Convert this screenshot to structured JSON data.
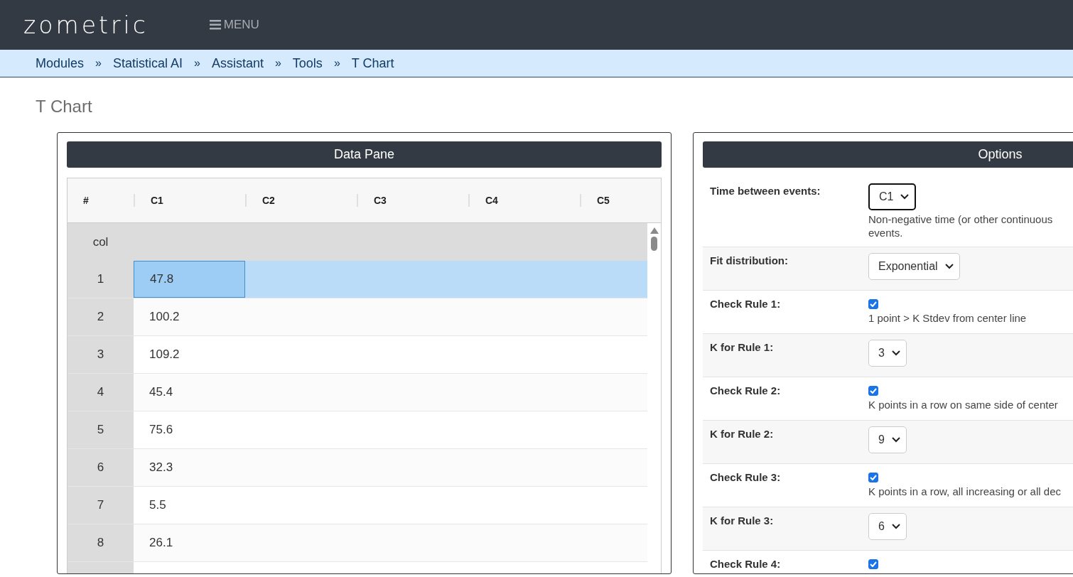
{
  "navbar": {
    "logo": "zometric",
    "menu_label": "MENU"
  },
  "breadcrumb": [
    "Modules",
    "Statistical AI",
    "Assistant",
    "Tools",
    "T Chart"
  ],
  "breadcrumb_separator": "»",
  "page_title": "T Chart",
  "data_pane": {
    "title": "Data Pane",
    "columns": [
      "#",
      "C1",
      "C2",
      "C3",
      "C4",
      "C5"
    ],
    "name_row_label": "col",
    "rows": [
      {
        "number": "1",
        "value": "47.8",
        "selected": true
      },
      {
        "number": "2",
        "value": "100.2",
        "selected": false
      },
      {
        "number": "3",
        "value": "109.2",
        "selected": false
      },
      {
        "number": "4",
        "value": "45.4",
        "selected": false
      },
      {
        "number": "5",
        "value": "75.6",
        "selected": false
      },
      {
        "number": "6",
        "value": "32.3",
        "selected": false
      },
      {
        "number": "7",
        "value": "5.5",
        "selected": false
      },
      {
        "number": "8",
        "value": "26.1",
        "selected": false
      }
    ]
  },
  "options": {
    "title": "Options",
    "rows": [
      {
        "kind": "select",
        "label": "Time between events:",
        "value": "C1",
        "focused": true,
        "hint_lines": [
          "Non-negative time (or other continuous",
          "events."
        ]
      },
      {
        "kind": "select",
        "label": "Fit distribution:",
        "value": "Exponential",
        "focused": false
      },
      {
        "kind": "checkbox",
        "label": "Check Rule 1:",
        "checked": true,
        "hint_lines": [
          "1 point > K Stdev from center line"
        ]
      },
      {
        "kind": "select",
        "label": "K for Rule 1:",
        "value": "3",
        "focused": false
      },
      {
        "kind": "checkbox",
        "label": "Check Rule 2:",
        "checked": true,
        "hint_lines": [
          "K points in a row on same side of center"
        ]
      },
      {
        "kind": "select",
        "label": "K for Rule 2:",
        "value": "9",
        "focused": false
      },
      {
        "kind": "checkbox",
        "label": "Check Rule 3:",
        "checked": true,
        "hint_lines": [
          "K points in a row, all increasing or all dec"
        ]
      },
      {
        "kind": "select",
        "label": "K for Rule 3:",
        "value": "6",
        "focused": false
      },
      {
        "kind": "checkbox",
        "label": "Check Rule 4:",
        "checked": true
      }
    ]
  }
}
